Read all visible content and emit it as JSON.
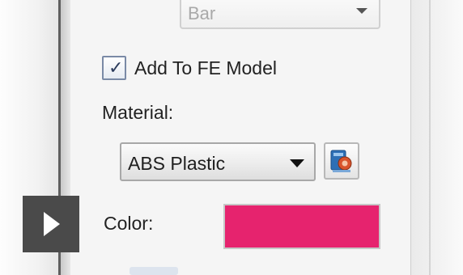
{
  "panel": {
    "top_select": {
      "value": "Bar"
    },
    "add_to_fe_model": {
      "label": "Add To FE Model",
      "checked": true,
      "check_glyph": "✓"
    },
    "material": {
      "label": "Material:",
      "selected": "ABS Plastic",
      "library_button_icon": "material-library-icon"
    },
    "color": {
      "label": "Color:",
      "swatch_color": "#e6236e"
    }
  },
  "overlay": {
    "play_icon": "play-icon"
  },
  "colors": {
    "panel_background": "#f5f5f5",
    "divider": "#5f5f5f",
    "play_background": "#4a4a4a"
  }
}
